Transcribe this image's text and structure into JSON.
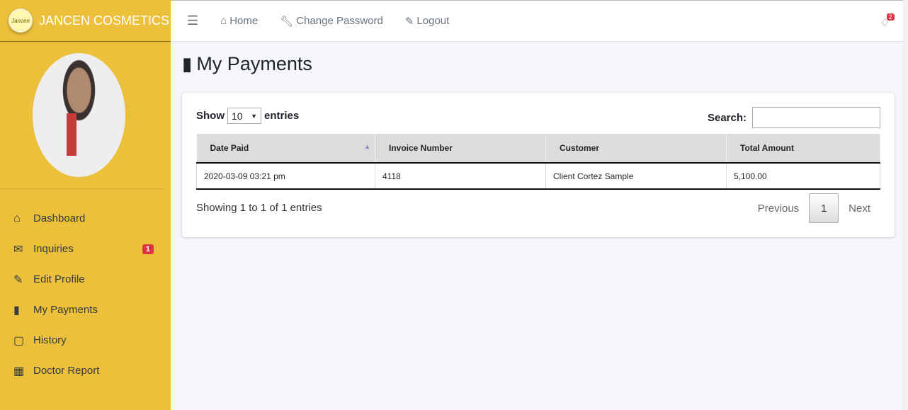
{
  "brand": {
    "name": "JANCEN COSMETICS",
    "logo_text": "Jancen"
  },
  "sidebar": {
    "items": [
      {
        "label": "Dashboard",
        "icon": "home-icon"
      },
      {
        "label": "Inquiries",
        "icon": "envelope-icon",
        "badge": "1"
      },
      {
        "label": "Edit Profile",
        "icon": "pencil-icon"
      },
      {
        "label": "My Payments",
        "icon": "file-icon"
      },
      {
        "label": "History",
        "icon": "calendar-icon"
      },
      {
        "label": "Doctor Report",
        "icon": "calendar-grid-icon"
      }
    ]
  },
  "topnav": {
    "home": "Home",
    "change_password": "Change Password",
    "logout": "Logout",
    "notification_count": "2"
  },
  "page": {
    "title": "My Payments"
  },
  "table_controls": {
    "show": "Show",
    "length": "10",
    "entries": "entries",
    "search_label": "Search:",
    "search_value": ""
  },
  "table": {
    "headers": [
      "Date Paid",
      "Invoice Number",
      "Customer",
      "Total Amount"
    ],
    "rows": [
      [
        "2020-03-09 03:21 pm",
        "4118",
        "Client Cortez Sample",
        "5,100.00"
      ]
    ]
  },
  "footer": {
    "info": "Showing 1 to 1 of 1 entries",
    "previous": "Previous",
    "page": "1",
    "next": "Next"
  }
}
